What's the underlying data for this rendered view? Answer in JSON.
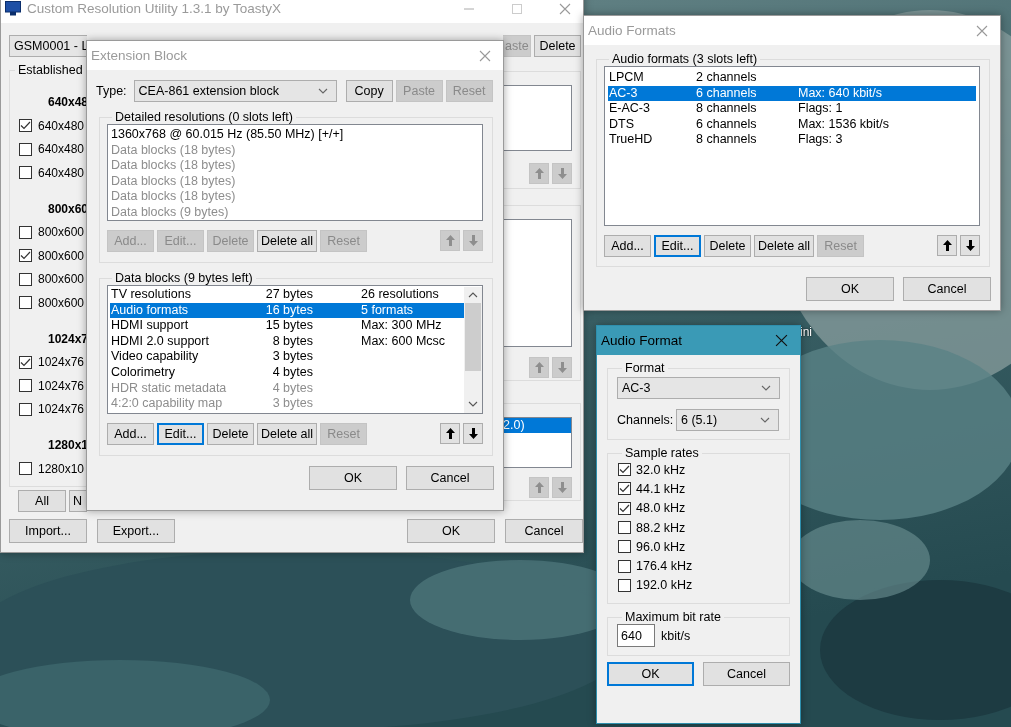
{
  "desktop": {
    "icon_label": "ini"
  },
  "main_window": {
    "title": "Custom Resolution Utility 1.3.1 by ToastyX",
    "active": false,
    "display": "GSM0001 - L",
    "top_buttons": [
      {
        "label": "aste",
        "disabled": true
      },
      {
        "label": "Delete",
        "disabled": false
      }
    ],
    "established_label": "Established",
    "resolution_groups": [
      {
        "heading": "640x48",
        "items": [
          {
            "label": "640x480",
            "checked": true
          },
          {
            "label": "640x480",
            "checked": false
          },
          {
            "label": "640x480",
            "checked": false
          }
        ]
      },
      {
        "heading": "800x60",
        "items": [
          {
            "label": "800x600",
            "checked": false
          },
          {
            "label": "800x600",
            "checked": true
          },
          {
            "label": "800x600",
            "checked": false
          },
          {
            "label": "800x600",
            "checked": false
          }
        ]
      },
      {
        "heading": "1024x7",
        "items": [
          {
            "label": "1024x76",
            "checked": true
          },
          {
            "label": "1024x76",
            "checked": false
          },
          {
            "label": "1024x76",
            "checked": false
          }
        ]
      },
      {
        "heading": "1280x1",
        "items": [
          {
            "label": "1280x10",
            "checked": false
          }
        ]
      }
    ],
    "select_buttons": [
      "All",
      "N"
    ],
    "side_lists": [
      {
        "arrows": [
          {
            "kind": "up",
            "disabled": true
          },
          {
            "kind": "down",
            "disabled": true
          }
        ]
      },
      {
        "arrows": [
          {
            "kind": "up",
            "disabled": true
          },
          {
            "kind": "down",
            "disabled": true
          }
        ]
      },
      {
        "rows": [
          {
            "text": "2.0)",
            "selected": true
          }
        ],
        "arrows": [
          {
            "kind": "up",
            "disabled": true
          },
          {
            "kind": "down",
            "disabled": true
          }
        ]
      }
    ],
    "footer_left": [
      "Import...",
      "Export..."
    ],
    "footer_right": [
      "OK",
      "Cancel"
    ]
  },
  "extension_block": {
    "title": "Extension Block",
    "active": false,
    "type_label": "Type:",
    "type_value": "CEA-861 extension block",
    "type_buttons": [
      {
        "label": "Copy",
        "disabled": false
      },
      {
        "label": "Paste",
        "disabled": true
      },
      {
        "label": "Reset",
        "disabled": true
      }
    ],
    "detailed": {
      "label": "Detailed resolutions (0 slots left)",
      "rows": [
        {
          "text": "1360x768 @ 60.015 Hz (85.50 MHz) [+/+]",
          "disabled": false
        },
        {
          "text": "Data blocks (18 bytes)",
          "disabled": true
        },
        {
          "text": "Data blocks (18 bytes)",
          "disabled": true
        },
        {
          "text": "Data blocks (18 bytes)",
          "disabled": true
        },
        {
          "text": "Data blocks (18 bytes)",
          "disabled": true
        },
        {
          "text": "Data blocks (9 bytes)",
          "disabled": true
        }
      ],
      "buttons": [
        {
          "label": "Add...",
          "disabled": true,
          "focused": false
        },
        {
          "label": "Edit...",
          "disabled": true,
          "focused": false
        },
        {
          "label": "Delete",
          "disabled": true,
          "focused": false
        },
        {
          "label": "Delete all",
          "disabled": false,
          "focused": false
        },
        {
          "label": "Reset",
          "disabled": true,
          "focused": false
        }
      ],
      "arrows": [
        {
          "kind": "up",
          "disabled": true
        },
        {
          "kind": "down",
          "disabled": true
        }
      ]
    },
    "data_blocks": {
      "label": "Data blocks (9 bytes left)",
      "rows": [
        {
          "name": "TV resolutions",
          "size": "27 bytes",
          "info": "26 resolutions",
          "selected": false,
          "disabled": false
        },
        {
          "name": "Audio formats",
          "size": "16 bytes",
          "info": "5 formats",
          "selected": true,
          "disabled": false
        },
        {
          "name": "HDMI support",
          "size": "15 bytes",
          "info": "Max: 300 MHz",
          "selected": false,
          "disabled": false
        },
        {
          "name": "HDMI 2.0 support",
          "size": "8 bytes",
          "info": "Max: 600 Mcsc",
          "selected": false,
          "disabled": false
        },
        {
          "name": "Video capability",
          "size": "3 bytes",
          "selected": false,
          "disabled": false
        },
        {
          "name": "Colorimetry",
          "size": "4 bytes",
          "selected": false,
          "disabled": false
        },
        {
          "name": "HDR static metadata",
          "size": "4 bytes",
          "selected": false,
          "disabled": true
        },
        {
          "name": "4:2:0 capability map",
          "size": "3 bytes",
          "selected": false,
          "disabled": true
        }
      ],
      "buttons": [
        {
          "label": "Add...",
          "disabled": false,
          "focused": false
        },
        {
          "label": "Edit...",
          "disabled": false,
          "focused": true
        },
        {
          "label": "Delete",
          "disabled": false,
          "focused": false
        },
        {
          "label": "Delete all",
          "disabled": false,
          "focused": false
        },
        {
          "label": "Reset",
          "disabled": true,
          "focused": false
        }
      ],
      "arrows": [
        {
          "kind": "up",
          "disabled": false
        },
        {
          "kind": "down",
          "disabled": false
        }
      ]
    },
    "buttons": [
      "OK",
      "Cancel"
    ]
  },
  "audio_formats": {
    "title": "Audio Formats",
    "active": false,
    "label": "Audio formats (3 slots left)",
    "rows": [
      {
        "format": "LPCM",
        "channels": "2 channels",
        "selected": false
      },
      {
        "format": "AC-3",
        "channels": "6 channels",
        "info": "Max: 640 kbit/s",
        "selected": true
      },
      {
        "format": "E-AC-3",
        "channels": "8 channels",
        "info": "Flags: 1",
        "selected": false
      },
      {
        "format": "DTS",
        "channels": "6 channels",
        "info": "Max: 1536 kbit/s",
        "selected": false
      },
      {
        "format": "TrueHD",
        "channels": "8 channels",
        "info": "Flags: 3",
        "selected": false
      }
    ],
    "buttons": [
      {
        "label": "Add...",
        "disabled": false,
        "focused": false
      },
      {
        "label": "Edit...",
        "disabled": false,
        "focused": true
      },
      {
        "label": "Delete",
        "disabled": false,
        "focused": false
      },
      {
        "label": "Delete all",
        "disabled": false,
        "focused": false
      },
      {
        "label": "Reset",
        "disabled": true,
        "focused": false
      }
    ],
    "arrows": [
      {
        "kind": "up",
        "disabled": false
      },
      {
        "kind": "down",
        "disabled": false
      }
    ],
    "footer": [
      "OK",
      "Cancel"
    ]
  },
  "audio_format": {
    "title": "Audio Format",
    "active": true,
    "format_label": "Format",
    "format_value": "AC-3",
    "channels_label": "Channels:",
    "channels_value": "6 (5.1)",
    "rates_label": "Sample rates",
    "rates": [
      {
        "label": "32.0 kHz",
        "checked": true
      },
      {
        "label": "44.1 kHz",
        "checked": true
      },
      {
        "label": "48.0 kHz",
        "checked": true
      },
      {
        "label": "88.2 kHz",
        "checked": false
      },
      {
        "label": "96.0 kHz",
        "checked": false
      },
      {
        "label": "176.4 kHz",
        "checked": false
      },
      {
        "label": "192.0 kHz",
        "checked": false
      }
    ],
    "bitrate_label": "Maximum bit rate",
    "bitrate_value": "640",
    "bitrate_unit": "kbit/s",
    "buttons": [
      {
        "label": "OK",
        "focused": true
      },
      {
        "label": "Cancel",
        "focused": false
      }
    ]
  }
}
